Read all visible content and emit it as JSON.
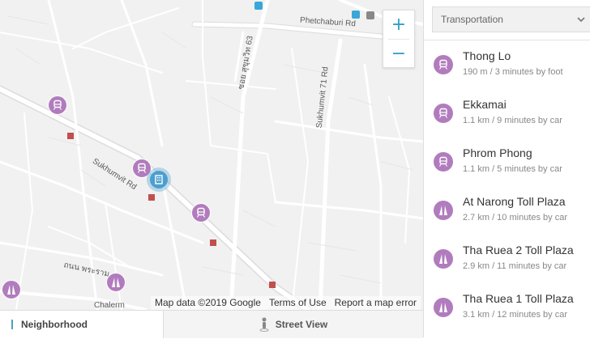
{
  "map": {
    "road_labels": {
      "phetchaburi": "Phetchaburi Rd",
      "sukhumvit": "Sukhumvit Rd",
      "sukhumvit71": "Sukhumvit 71 Rd",
      "soi63": "ซอย สุขุมวิท 63",
      "pra": "ถนน พระราม",
      "chalerm": "Chalerm"
    },
    "zoom_in": "+",
    "zoom_out": "−",
    "attribution": {
      "map_data": "Map data ©2019 Google",
      "terms": "Terms of Use",
      "report": "Report a map error"
    },
    "marker_icons": [
      "train-icon",
      "road-icon",
      "home-icon"
    ],
    "colors": {
      "marker": "#b17cbd",
      "home": "#4b9fd0",
      "accent": "#2fa0c7"
    }
  },
  "tabs": {
    "neighborhood": "Neighborhood",
    "street_view": "Street View"
  },
  "panel": {
    "select_value": "Transportation",
    "items": [
      {
        "icon": "train-icon",
        "name": "Thong Lo",
        "distance": "190 m / 3 minutes by foot"
      },
      {
        "icon": "train-icon",
        "name": "Ekkamai",
        "distance": "1.1 km / 9 minutes by car"
      },
      {
        "icon": "train-icon",
        "name": "Phrom Phong",
        "distance": "1.1 km / 5 minutes by car"
      },
      {
        "icon": "road-icon",
        "name": "At Narong Toll Plaza",
        "distance": "2.7 km / 10 minutes by car"
      },
      {
        "icon": "road-icon",
        "name": "Tha Ruea 2 Toll Plaza",
        "distance": "2.9 km / 11 minutes by car"
      },
      {
        "icon": "road-icon",
        "name": "Tha Ruea 1 Toll Plaza",
        "distance": "3.1 km / 12 minutes by car"
      }
    ]
  }
}
